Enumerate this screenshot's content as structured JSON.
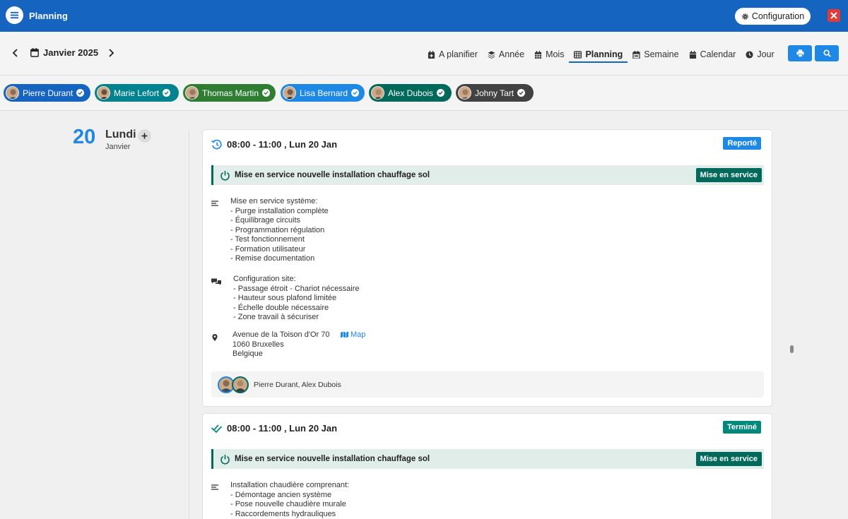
{
  "header": {
    "title": "Planning",
    "config_label": "Configuration"
  },
  "toolbar": {
    "month_label": "Janvier 2025",
    "views": [
      {
        "label": "A planifier",
        "icon": "calendar-plus-icon"
      },
      {
        "label": "Année",
        "icon": "layers-icon"
      },
      {
        "label": "Mois",
        "icon": "calendar-grid-icon"
      },
      {
        "label": "Planning",
        "icon": "table-icon",
        "active": true
      },
      {
        "label": "Semaine",
        "icon": "calendar-week-icon"
      },
      {
        "label": "Calendar",
        "icon": "calendar-icon"
      },
      {
        "label": "Jour",
        "icon": "clock-icon"
      }
    ]
  },
  "technicians": [
    {
      "name": "Pierre Durant",
      "color": "#1565c0"
    },
    {
      "name": "Marie Lefort",
      "color": "#00838f"
    },
    {
      "name": "Thomas Martin",
      "color": "#2e7d32"
    },
    {
      "name": "Lisa Bernard",
      "color": "#1e88e5"
    },
    {
      "name": "Alex Dubois",
      "color": "#00695c"
    },
    {
      "name": "Johny Tart",
      "color": "#424242"
    }
  ],
  "day": {
    "number": "20",
    "name": "Lundi",
    "month": "Janvier"
  },
  "cards": [
    {
      "time": "08:00 - 11:00 , Lun 20 Jan",
      "status": "Reporté",
      "status_color": "#1e88e5",
      "job_title": "Mise en service nouvelle installation chauffage sol",
      "job_type": "Mise en service",
      "description": "Mise en service système:\n- Purge installation complète\n- Équilibrage circuits\n- Programmation régulation\n- Test fonctionnement\n- Formation utilisateur\n- Remise documentation",
      "notes": "Configuration site:\n- Passage étroit - Chariot nécessaire\n- Hauteur sous plafond limitée\n- Échelle double nécessaire\n- Zone travail à sécuriser",
      "address": "Avenue de la Toison d'Or 70\n1060 Bruxelles\nBelgique",
      "map_label": "Map",
      "assignees": "Pierre Durant, Alex Dubois"
    },
    {
      "time": "08:00 - 11:00 , Lun 20 Jan",
      "status": "Terminé",
      "status_color": "#00897b",
      "job_title": "Mise en service nouvelle installation chauffage sol",
      "job_type": "Mise en service",
      "description": "Installation chaudière comprenant:\n- Démontage ancien système\n- Pose nouvelle chaudière murale\n- Raccordements hydrauliques"
    }
  ]
}
